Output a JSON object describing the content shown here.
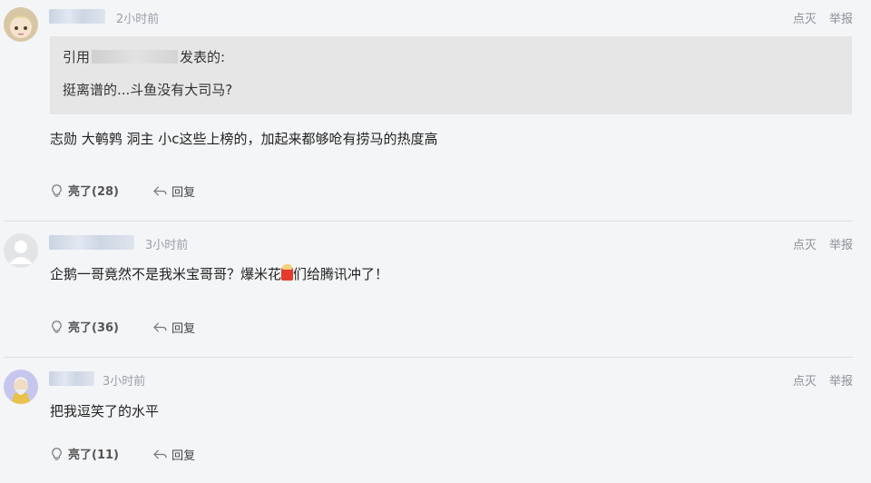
{
  "comments": [
    {
      "time": "2小时前",
      "ops": {
        "dislike": "点灭",
        "report": "举报"
      },
      "quote": {
        "prefix": "引用",
        "suffix": "发表的:",
        "text": "挺离谱的...斗鱼没有大司马?"
      },
      "content": "志勋 大鹌鹑 洞主 小c这些上榜的，加起来都够呛有捞马的热度高",
      "actions": {
        "like": "亮了(28)",
        "reply": "回复"
      }
    },
    {
      "time": "3小时前",
      "ops": {
        "dislike": "点灭",
        "report": "举报"
      },
      "content_a": "企鹅一哥竟然不是我米宝哥哥？爆米花",
      "content_b": "们给腾讯冲了！",
      "actions": {
        "like": "亮了(36)",
        "reply": "回复"
      }
    },
    {
      "time": "3小时前",
      "ops": {
        "dislike": "点灭",
        "report": "举报"
      },
      "content": "把我逗笑了的水平",
      "actions": {
        "like": "亮了(11)",
        "reply": "回复"
      }
    }
  ],
  "icons": {
    "like": "lightbulb-icon",
    "reply": "reply-arrow-icon",
    "emoji": "popcorn-icon"
  }
}
